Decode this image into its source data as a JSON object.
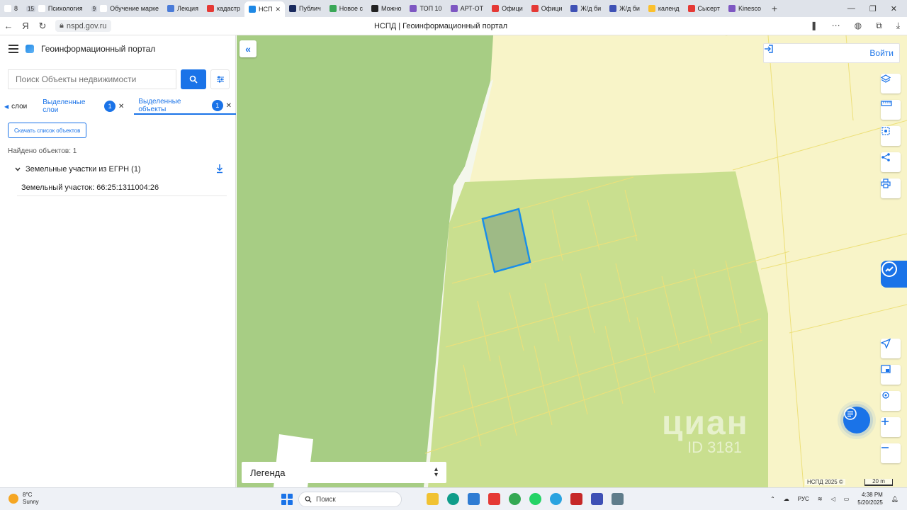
{
  "browser": {
    "tabs": [
      {
        "label": "8",
        "count": "",
        "color": "#ffffff",
        "icon": "page-icon"
      },
      {
        "label": "Психология",
        "count": "15",
        "color": "#ffffff",
        "icon": "page-icon"
      },
      {
        "label": "Обучение марке",
        "count": "9",
        "color": "#ffffff",
        "icon": "page-icon"
      },
      {
        "label": "Лекция",
        "count": "",
        "color": "#4a7bd8",
        "icon": "drive-icon"
      },
      {
        "label": "кадастр",
        "count": "",
        "color": "#e53935",
        "icon": "yandex-icon"
      },
      {
        "label": "Публич",
        "count": "",
        "color": "#1a2a5e",
        "icon": "page-icon"
      },
      {
        "label": "Новое с",
        "count": "",
        "color": "#3aa757",
        "icon": "page-icon"
      },
      {
        "label": "Можно",
        "count": "",
        "color": "#222222",
        "icon": "page-icon"
      },
      {
        "label": "ТОП 10",
        "count": "",
        "color": "#7e57c2",
        "icon": "page-icon"
      },
      {
        "label": "АРТ-ОТ",
        "count": "",
        "color": "#7e57c2",
        "icon": "page-icon"
      },
      {
        "label": "Офици",
        "count": "",
        "color": "#e53935",
        "icon": "page-icon"
      },
      {
        "label": "Офици",
        "count": "",
        "color": "#e53935",
        "icon": "page-icon"
      },
      {
        "label": "Ж/д би",
        "count": "",
        "color": "#3f51b5",
        "icon": "page-icon"
      },
      {
        "label": "Ж/д би",
        "count": "",
        "color": "#3f51b5",
        "icon": "page-icon"
      },
      {
        "label": "календ",
        "count": "",
        "color": "#fbc02d",
        "icon": "page-icon"
      },
      {
        "label": "Сысерт",
        "count": "",
        "color": "#e53935",
        "icon": "map-pin-icon"
      },
      {
        "label": "Kinesco",
        "count": "",
        "color": "#7e57c2",
        "icon": "page-icon"
      }
    ],
    "active_tab": {
      "label": "НСП",
      "color": "#1e88e5",
      "icon": "nspd-icon"
    },
    "url": "nspd.gov.ru",
    "page_title": "НСПД | Геоинформационный портал"
  },
  "sidebar": {
    "app_title": "Геоинформационный портал",
    "search_placeholder": "Поиск Объекты недвижимости",
    "tab_layers": "слои",
    "tab_selected_layers": "Выделенные слои",
    "tab_selected_layers_count": "1",
    "tab_selected_objects": "Выделенные объекты",
    "tab_selected_objects_count": "1",
    "download_list_label": "Скачать список объектов",
    "found_text": "Найдено объектов: 1",
    "group_label": "Земельные участки из ЕГРН (1)",
    "item_label": "Земельный участок: 66:25:1311004:26"
  },
  "map": {
    "login_label": "Войти",
    "legend_label": "Легенда",
    "copyright": "НСПД 2025 ©",
    "scale_label": "20 m",
    "watermark_main": "циан",
    "watermark_id": "ID 3181",
    "colors": {
      "background": "#f8f4c8",
      "forest": "#a7cd84",
      "parcel_area": "#c9df8f",
      "boundary": "#ede07a",
      "selected": "#1a8ee8"
    }
  },
  "taskbar": {
    "weather_temp": "8°C",
    "weather_desc": "Sunny",
    "search_label": "Поиск",
    "lang": "РУС",
    "time": "4:38 PM",
    "date": "5/20/2025"
  }
}
